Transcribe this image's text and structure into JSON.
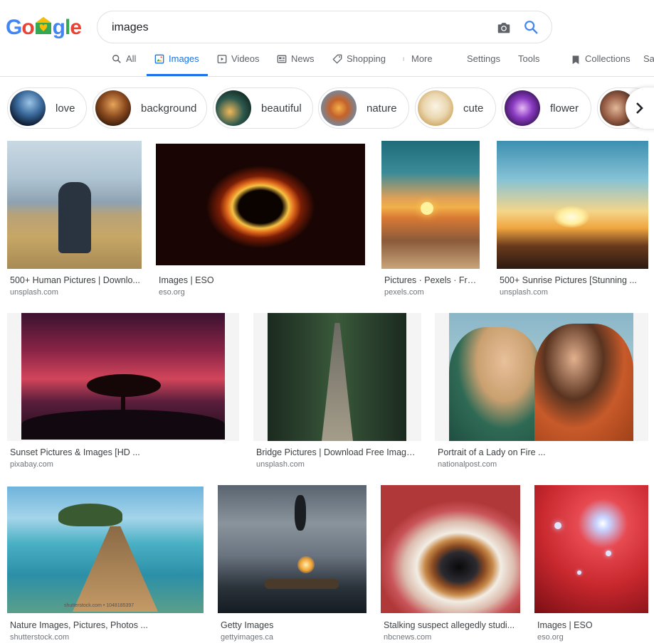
{
  "logo": {
    "letters": [
      "G",
      "o",
      "",
      "g",
      "l",
      "e"
    ]
  },
  "search": {
    "value": "images"
  },
  "tabs": [
    {
      "label": "All"
    },
    {
      "label": "Images"
    },
    {
      "label": "Videos"
    },
    {
      "label": "News"
    },
    {
      "label": "Shopping"
    },
    {
      "label": "More"
    },
    {
      "label": "Settings"
    },
    {
      "label": "Tools"
    },
    {
      "label": "Collections"
    },
    {
      "label": "Sa"
    }
  ],
  "chips": [
    {
      "label": "love"
    },
    {
      "label": "background"
    },
    {
      "label": "beautiful"
    },
    {
      "label": "nature"
    },
    {
      "label": "cute"
    },
    {
      "label": "flower"
    }
  ],
  "results": [
    {
      "title": "500+ Human Pictures | Downlo...",
      "domain": "unsplash.com"
    },
    {
      "title": "Images | ESO",
      "domain": "eso.org"
    },
    {
      "title": "Pictures · Pexels · Free ...",
      "domain": "pexels.com"
    },
    {
      "title": "500+ Sunrise Pictures [Stunning ...",
      "domain": "unsplash.com"
    },
    {
      "title": "Sunset Pictures & Images [HD ...",
      "domain": "pixabay.com"
    },
    {
      "title": "Bridge Pictures | Download Free Image...",
      "domain": "unsplash.com"
    },
    {
      "title": "Portrait of a Lady on Fire ...",
      "domain": "nationalpost.com"
    },
    {
      "title": "Nature Images, Pictures, Photos ...",
      "domain": "shutterstock.com",
      "watermark": "shutterstock.com • 1048185397"
    },
    {
      "title": "Getty Images",
      "domain": "gettyimages.ca"
    },
    {
      "title": "Stalking suspect allegedly studi...",
      "domain": "nbcnews.com"
    },
    {
      "title": "Images | ESO",
      "domain": "eso.org"
    }
  ],
  "colors": {
    "accent": "#1a73e8",
    "logo_blue": "#4285f4",
    "logo_red": "#ea4335",
    "logo_yellow": "#fbbc05",
    "logo_green": "#34a853"
  }
}
